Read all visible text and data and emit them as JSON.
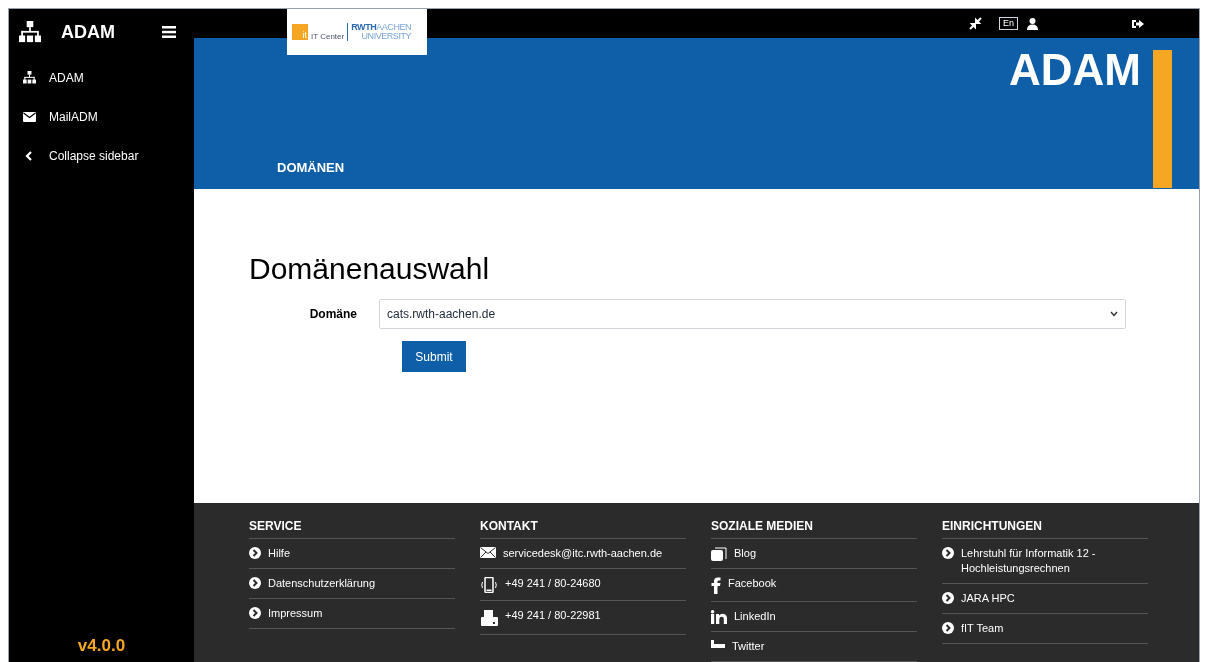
{
  "sidebar": {
    "title": "ADAM",
    "items": [
      {
        "label": "ADAM",
        "kind": "tree"
      },
      {
        "label": "MailADM",
        "kind": "mail"
      },
      {
        "label": "Collapse sidebar",
        "kind": "collapse"
      }
    ],
    "version": "v4.0.0"
  },
  "topbar": {
    "language": "En"
  },
  "logo": {
    "mark": "it",
    "subtitle": "IT Center",
    "brand_bold": "RWTH",
    "brand_light": "AACHEN",
    "brand_second": "UNIVERSITY"
  },
  "header": {
    "title": "ADAM",
    "nav": "DOMÄNEN"
  },
  "form": {
    "heading": "Domänenauswahl",
    "label": "Domäne",
    "value": "cats.rwth-aachen.de",
    "submit": "Submit"
  },
  "footer": [
    {
      "title": "SERVICE",
      "kind": "links",
      "items": [
        "Hilfe",
        "Datenschutzerklärung",
        "Impressum"
      ]
    },
    {
      "title": "KONTAKT",
      "kind": "contact",
      "items": [
        "servicedesk@itc.rwth-aachen.de",
        "+49 241 / 80-24680",
        "+49 241 / 80-22981"
      ]
    },
    {
      "title": "SOZIALE MEDIEN",
      "kind": "social",
      "items": [
        "Blog",
        "Facebook",
        "LinkedIn",
        "Twitter"
      ]
    },
    {
      "title": "EINRICHTUNGEN",
      "kind": "links",
      "items": [
        "Lehrstuhl für Informatik 12 - Hochleistungsrechnen",
        "JARA HPC",
        "fIT Team"
      ]
    }
  ]
}
